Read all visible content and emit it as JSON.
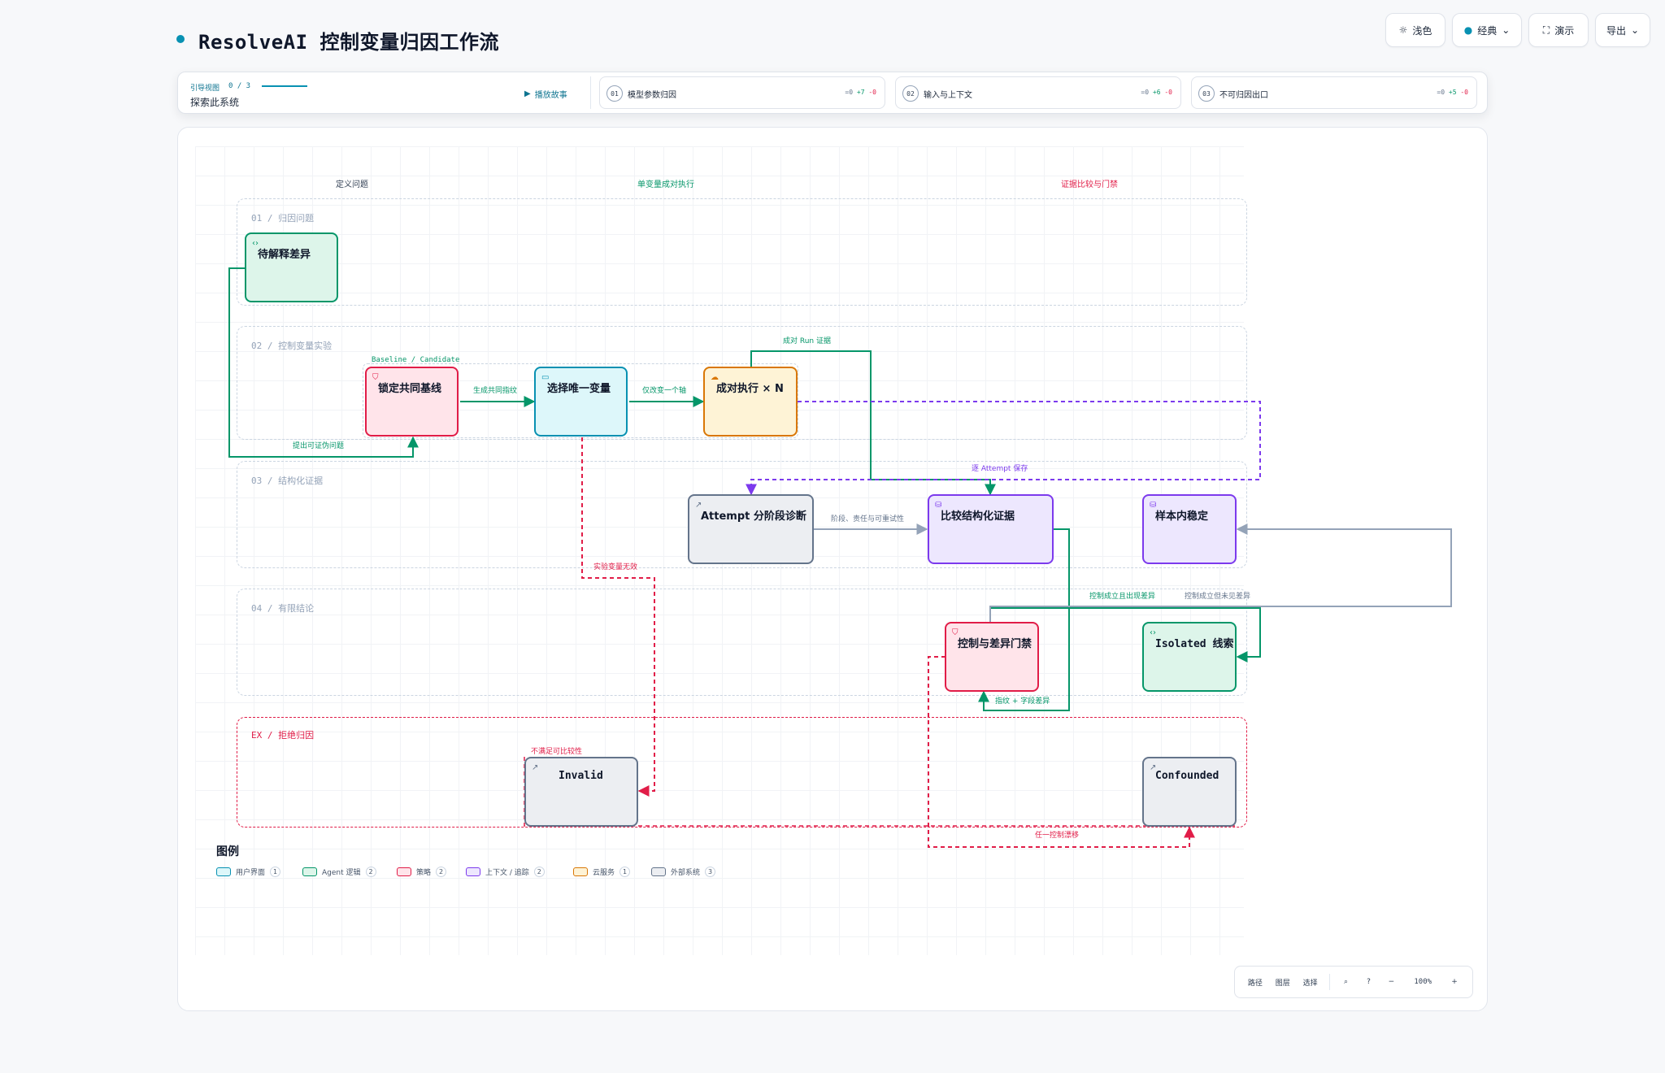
{
  "app": {
    "title": "ResolveAI 控制变量归因工作流"
  },
  "toolbar": {
    "theme": "浅色",
    "style": "经典",
    "present": "演示",
    "export": "导出"
  },
  "guide": {
    "label": "引导视图",
    "progress": "0 / 3",
    "subtitle": "探索此系统",
    "play": "播放故事",
    "steps": [
      {
        "num": "01",
        "label": "模型参数归因",
        "zero": "=0",
        "plus": "+7",
        "minus": "-0"
      },
      {
        "num": "02",
        "label": "输入与上下文",
        "zero": "=0",
        "plus": "+6",
        "minus": "-0"
      },
      {
        "num": "03",
        "label": "不可归因出口",
        "zero": "=0",
        "plus": "+5",
        "minus": "-0"
      }
    ]
  },
  "columns": [
    "定义问题",
    "单变量成对执行",
    "证据比较与门禁"
  ],
  "lanes": [
    "01 / 归因问题",
    "02 / 控制变量实验",
    "03 / 结构化证据",
    "04 / 有限结论",
    "EX / 拒绝归因"
  ],
  "nodes": {
    "unexplained": "待解释差异",
    "baseline": "锁定共同基线",
    "select": "选择唯一变量",
    "pair": "成对执行 × N",
    "attempt": "Attempt 分阶段诊断",
    "compare": "比较结构化证据",
    "stable": "样本内稳定",
    "gate": "控制与差异门禁",
    "isolated": "Isolated 线索",
    "invalid": "Invalid",
    "confounded": "Confounded",
    "baseline_tag": "Baseline / Candidate"
  },
  "edges": {
    "falsifiable": "提出可证伪问题",
    "shared_protocol": "生成共同指纹",
    "one_change": "仅改变一个轴",
    "paired_evidence": "成对 Run 证据",
    "attempt_keep": "逐 Attempt 保存",
    "stage": "阶段、责任与可重试性",
    "invalid_var": "实验变量无效",
    "diff_shown": "控制成立且出现差异",
    "diff_none": "控制成立但未见差异",
    "fingerprint": "指纹 + 字段差异",
    "not_comparable": "不满足可比较性",
    "any_drift": "任一控制漂移"
  },
  "legend": {
    "title": "图例",
    "items": [
      {
        "label": "用户界面",
        "count": "1",
        "color": "#0891b2"
      },
      {
        "label": "Agent 逻辑",
        "count": "2",
        "color": "#059669"
      },
      {
        "label": "策略",
        "count": "2",
        "color": "#e11d48"
      },
      {
        "label": "上下文 / 追踪",
        "count": "2",
        "color": "#7c3aed"
      },
      {
        "label": "云服务",
        "count": "1",
        "color": "#d97706"
      },
      {
        "label": "外部系统",
        "count": "3",
        "color": "#64748b"
      }
    ]
  },
  "zoom": {
    "path": "路径",
    "layers": "图层",
    "select": "选择",
    "level": "100%",
    "minus": "−",
    "plus": "+"
  }
}
